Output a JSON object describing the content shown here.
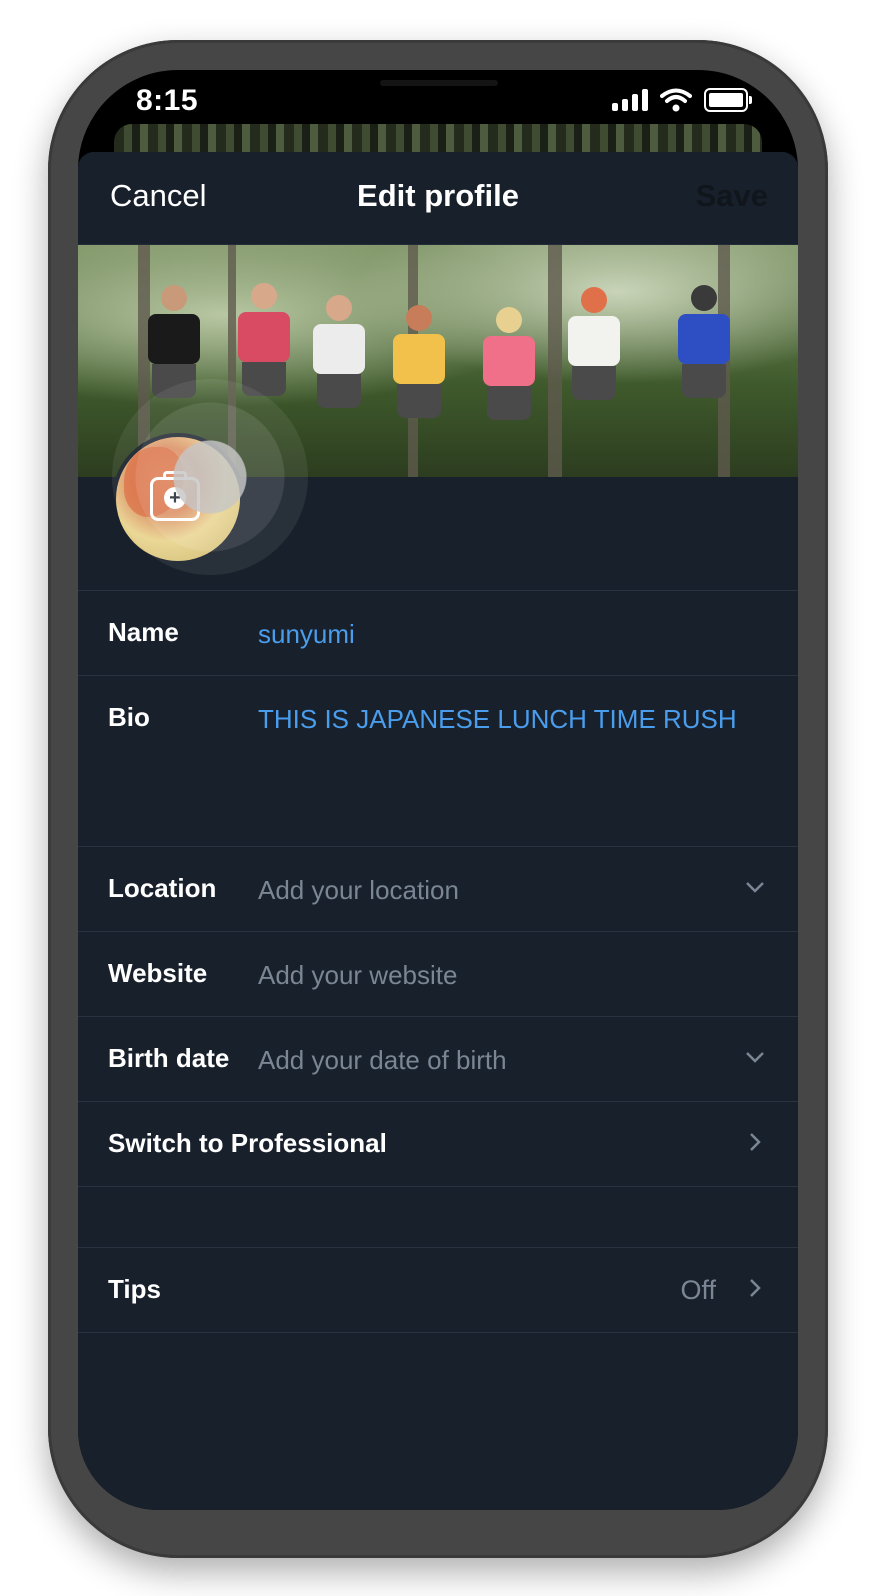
{
  "status_bar": {
    "time": "8:15"
  },
  "nav": {
    "cancel": "Cancel",
    "title": "Edit profile",
    "save": "Save"
  },
  "fields": {
    "name": {
      "label": "Name",
      "value": "sunyumi"
    },
    "bio": {
      "label": "Bio",
      "value": "THIS IS JAPANESE LUNCH TIME RUSH"
    },
    "location": {
      "label": "Location",
      "placeholder": "Add your location"
    },
    "website": {
      "label": "Website",
      "placeholder": "Add your website"
    },
    "birth_date": {
      "label": "Birth date",
      "placeholder": "Add your date of birth"
    }
  },
  "professional": {
    "label": "Switch to Professional"
  },
  "tips": {
    "label": "Tips",
    "value": "Off"
  },
  "colors": {
    "link": "#4a9ded",
    "background": "#18202b",
    "secondary_text": "#7a8694"
  }
}
